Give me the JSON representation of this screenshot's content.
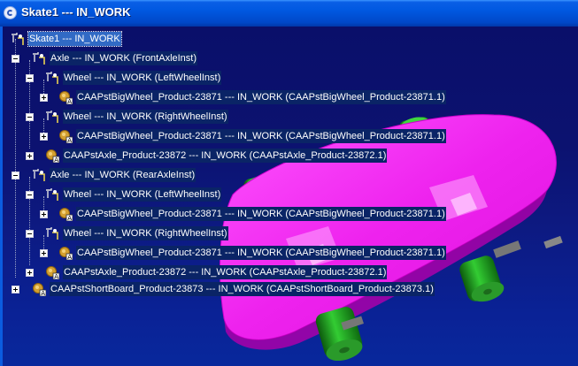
{
  "window": {
    "title": "Skate1 --- IN_WORK",
    "icon": "catia-app-icon"
  },
  "colors": {
    "background_top": "#0a0f6a",
    "background_bottom": "#08289c",
    "board": "#ff33ff",
    "wheel": "#22aa22",
    "selection": "#316ac5"
  },
  "tree": [
    {
      "label": "Skate1 --- IN_WORK",
      "icon": "product-icon",
      "expander": "none",
      "selected": true
    },
    {
      "label": "Axle --- IN_WORK (FrontAxleInst)",
      "icon": "product-icon",
      "expander": "minus"
    },
    {
      "label": "Wheel --- IN_WORK (LeftWheelInst)",
      "icon": "product-icon",
      "expander": "minus"
    },
    {
      "label": "CAAPstBigWheel_Product-23871 --- IN_WORK (CAAPstBigWheel_Product-23871.1)",
      "icon": "part-icon",
      "expander": "plus"
    },
    {
      "label": "Wheel --- IN_WORK (RightWheelInst)",
      "icon": "product-icon",
      "expander": "minus"
    },
    {
      "label": "CAAPstBigWheel_Product-23871 --- IN_WORK (CAAPstBigWheel_Product-23871.1)",
      "icon": "part-icon",
      "expander": "plus"
    },
    {
      "label": "CAAPstAxle_Product-23872 --- IN_WORK (CAAPstAxle_Product-23872.1)",
      "icon": "part-icon",
      "expander": "plus"
    },
    {
      "label": "Axle --- IN_WORK (RearAxleInst)",
      "icon": "product-icon",
      "expander": "minus"
    },
    {
      "label": "Wheel --- IN_WORK (LeftWheelInst)",
      "icon": "product-icon",
      "expander": "minus"
    },
    {
      "label": "CAAPstBigWheel_Product-23871 --- IN_WORK (CAAPstBigWheel_Product-23871.1)",
      "icon": "part-icon",
      "expander": "plus"
    },
    {
      "label": "Wheel --- IN_WORK (RightWheelInst)",
      "icon": "product-icon",
      "expander": "minus"
    },
    {
      "label": "CAAPstBigWheel_Product-23871 --- IN_WORK (CAAPstBigWheel_Product-23871.1)",
      "icon": "part-icon",
      "expander": "plus"
    },
    {
      "label": "CAAPstAxle_Product-23872 --- IN_WORK (CAAPstAxle_Product-23872.1)",
      "icon": "part-icon",
      "expander": "plus"
    },
    {
      "label": "CAAPstShortBoard_Product-23873 --- IN_WORK (CAAPstShortBoard_Product-23873.1)",
      "icon": "part-icon",
      "expander": "plus"
    }
  ]
}
